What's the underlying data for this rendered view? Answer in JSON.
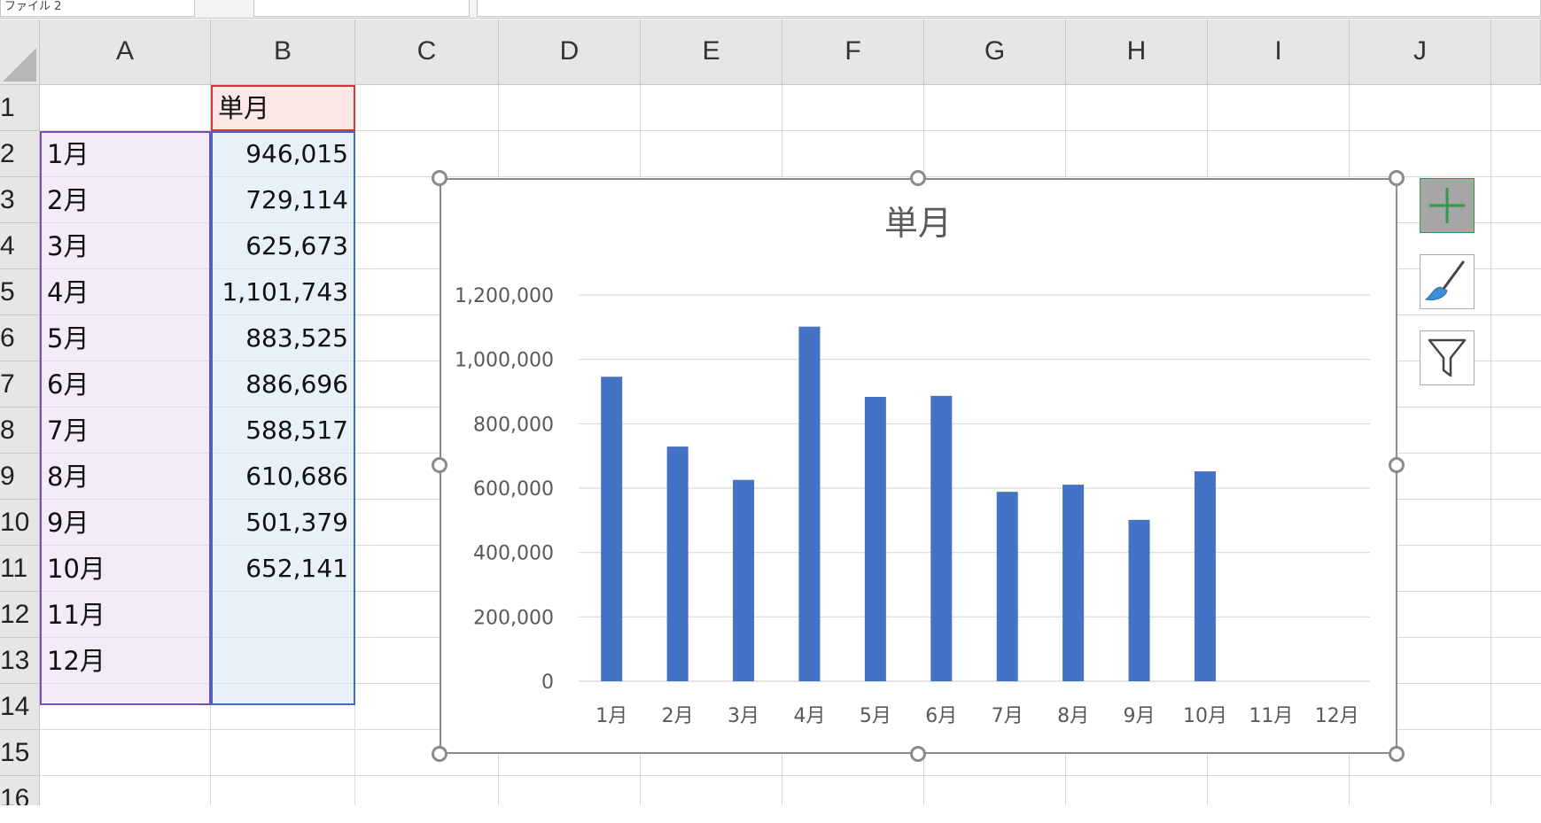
{
  "sheet_tabs": [
    {
      "label": "ファイル 2"
    },
    {
      "label": ""
    },
    {
      "label": ""
    }
  ],
  "columns": [
    "A",
    "B",
    "C",
    "D",
    "E",
    "F",
    "G",
    "H",
    "I",
    "J"
  ],
  "rows": [
    "1",
    "2",
    "3",
    "4",
    "5",
    "6",
    "7",
    "8",
    "9",
    "10",
    "11",
    "12",
    "13",
    "14",
    "15",
    "16"
  ],
  "cells": {
    "B1": "単月",
    "A": [
      "1月",
      "2月",
      "3月",
      "4月",
      "5月",
      "6月",
      "7月",
      "8月",
      "9月",
      "10月",
      "11月",
      "12月"
    ],
    "B": [
      "946,015",
      "729,114",
      "625,673",
      "1,101,743",
      "883,525",
      "886,696",
      "588,517",
      "610,686",
      "501,379",
      "652,141",
      "",
      ""
    ]
  },
  "chart_data": {
    "type": "bar",
    "title": "単月",
    "categories": [
      "1月",
      "2月",
      "3月",
      "4月",
      "5月",
      "6月",
      "7月",
      "8月",
      "9月",
      "10月",
      "11月",
      "12月"
    ],
    "values": [
      946015,
      729114,
      625673,
      1101743,
      883525,
      886696,
      588517,
      610686,
      501379,
      652141,
      null,
      null
    ],
    "ylim": [
      0,
      1200000
    ],
    "yticks": [
      "0",
      "200,000",
      "400,000",
      "600,000",
      "800,000",
      "1,000,000",
      "1,200,000"
    ],
    "grid": true,
    "bar_color": "#4472c4",
    "xlabel": "",
    "ylabel": ""
  },
  "chart_tools": [
    {
      "icon": "plus-icon",
      "name": "chart-elements-button"
    },
    {
      "icon": "brush-icon",
      "name": "chart-styles-button"
    },
    {
      "icon": "filter-icon",
      "name": "chart-filters-button"
    }
  ],
  "colors": {
    "grid": "#dadada",
    "header_bg": "#e6e6e6",
    "selection_a": "#7a4fb0",
    "selection_b": "#3a6cc8",
    "selection_b1": "#d0383a"
  }
}
